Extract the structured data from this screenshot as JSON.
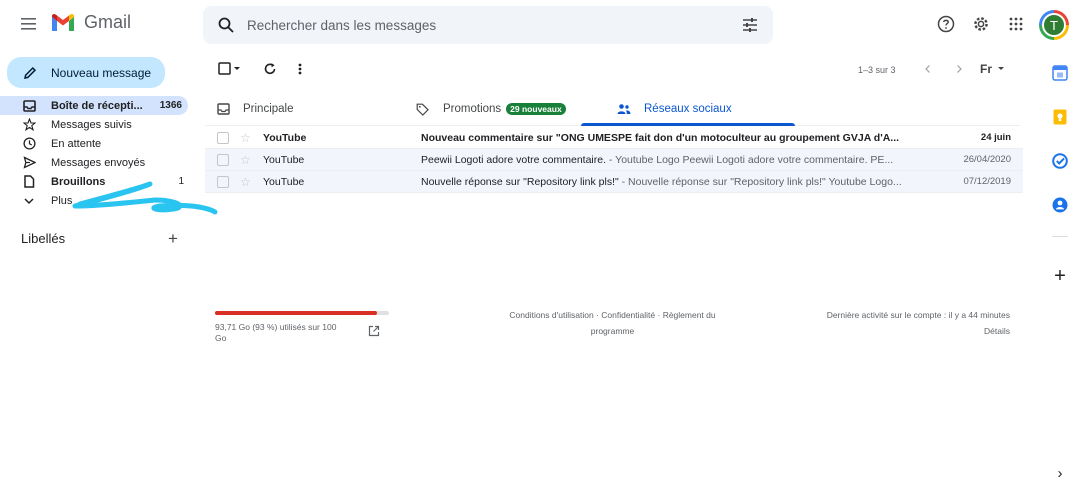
{
  "header": {
    "logo_text": "Gmail",
    "search_placeholder": "Rechercher dans les messages",
    "avatar_letter": "T"
  },
  "compose": {
    "label": "Nouveau message"
  },
  "sidebar": {
    "items": [
      {
        "label": "Boîte de récepti...",
        "count": "1366",
        "icon": "inbox-icon"
      },
      {
        "label": "Messages suivis",
        "count": "",
        "icon": "star-icon"
      },
      {
        "label": "En attente",
        "count": "",
        "icon": "clock-icon"
      },
      {
        "label": "Messages envoyés",
        "count": "",
        "icon": "send-icon"
      },
      {
        "label": "Brouillons",
        "count": "1",
        "icon": "file-icon"
      },
      {
        "label": "Plus",
        "count": "",
        "icon": "chevron-down-icon"
      }
    ],
    "labels_title": "Libellés",
    "labels_add": "+"
  },
  "toolbar": {
    "pager": "1–3 sur 3",
    "input_tool": "Fr"
  },
  "tabs": [
    {
      "label": "Principale",
      "badge": "",
      "active": false
    },
    {
      "label": "Promotions",
      "badge": "29 nouveaux",
      "active": false
    },
    {
      "label": "Réseaux sociaux",
      "badge": "",
      "active": true
    }
  ],
  "emails": [
    {
      "sender": "YouTube",
      "subject": "Nouveau commentaire sur \"ONG UMESPE fait don d'un motoculteur au groupement GVJA d'A...",
      "snippet": "",
      "date": "24 juin",
      "unread": true
    },
    {
      "sender": "YouTube",
      "subject": "Peewii Logoti adore votre commentaire.",
      "snippet": " - Youtube Logo Peewii Logoti adore votre commentaire. PE...",
      "date": "26/04/2020",
      "unread": false
    },
    {
      "sender": "YouTube",
      "subject": "Nouvelle réponse sur \"Repository link pls!\"",
      "snippet": " - Nouvelle réponse sur \"Repository link pls!\" Youtube Logo...",
      "date": "07/12/2019",
      "unread": false
    }
  ],
  "footer": {
    "storage_fraction": 0.93,
    "storage_text": "93,71 Go (93 %) utilisés sur 100 Go",
    "terms": "Conditions d'utilisation",
    "privacy": "Confidentialité",
    "program": "Règlement du programme",
    "last_activity": "Dernière activité sur le compte : il y a 44 minutes",
    "details": "Détails"
  },
  "side_panel": {
    "add_label": "+",
    "expand_label": "›"
  },
  "colors": {
    "compose_bg": "#c2e7ff",
    "active_nav_bg": "#d3e3fd",
    "accent": "#0b57d0",
    "badge_green": "#188038",
    "storage_red": "#d93025",
    "scribble": "#29c4f0"
  }
}
